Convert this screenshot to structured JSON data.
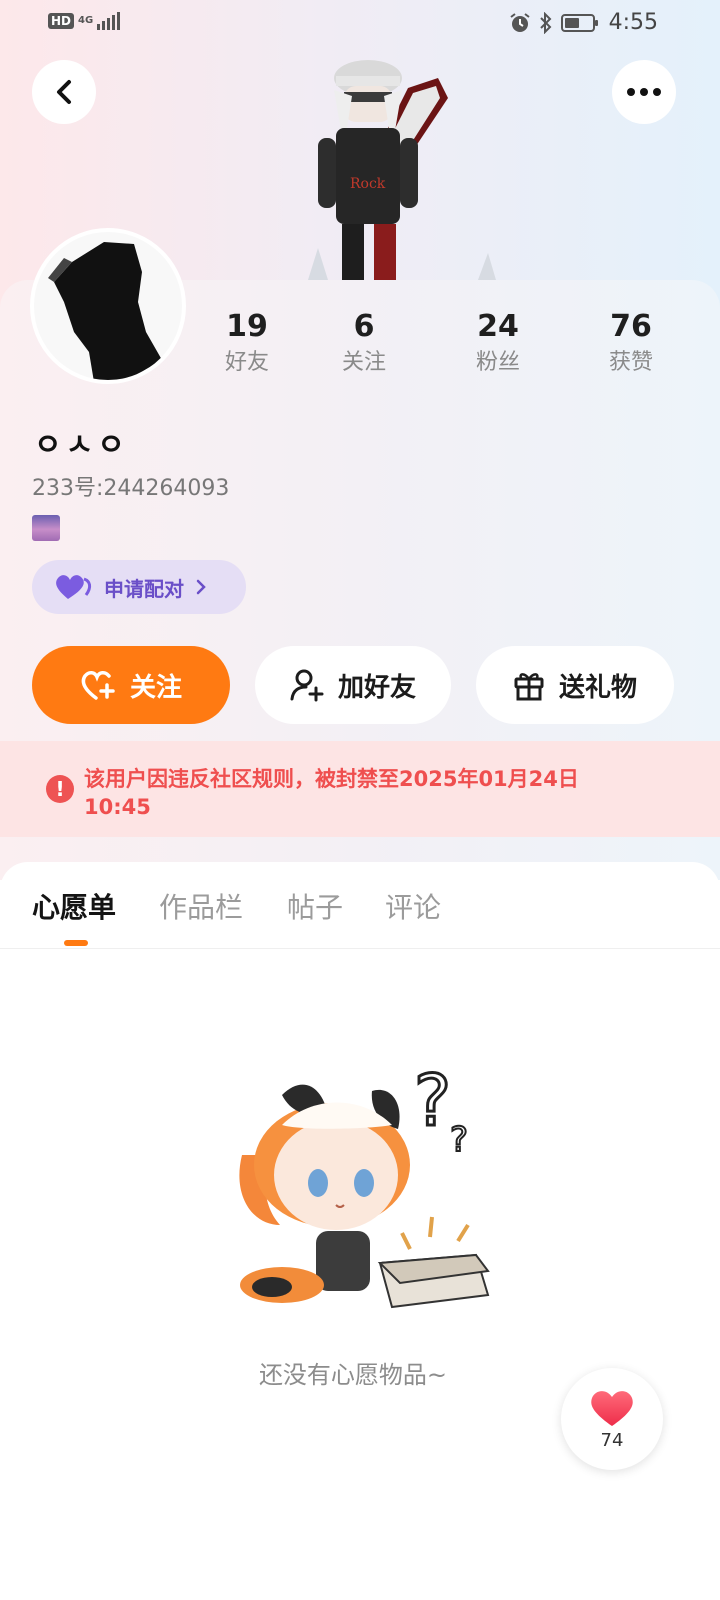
{
  "status_bar": {
    "hd": "HD",
    "network": "4G",
    "time": "4:55",
    "battery_level": 0.55,
    "icons": [
      "alarm-icon",
      "bluetooth-icon",
      "battery-icon"
    ]
  },
  "header": {
    "back_icon": "chevron-left-icon",
    "more_icon": "more-dots-icon"
  },
  "profile": {
    "stats": [
      {
        "value": "19",
        "label": "好友"
      },
      {
        "value": "6",
        "label": "关注"
      },
      {
        "value": "24",
        "label": "粉丝"
      },
      {
        "value": "76",
        "label": "获赞"
      }
    ],
    "nickname": "ㅇㅅㅇ",
    "uid": "233号:244264093",
    "pair_button": "申请配对"
  },
  "actions": {
    "follow": "关注",
    "add_friend": "加好友",
    "gift": "送礼物"
  },
  "ban_notice": "该用户因违反社区规则，被封禁至2025年01月24日10:45",
  "tabs": [
    {
      "label": "心愿单",
      "active": true
    },
    {
      "label": "作品栏",
      "active": false
    },
    {
      "label": "帖子",
      "active": false
    },
    {
      "label": "评论",
      "active": false
    }
  ],
  "empty_state": "还没有心愿物品~",
  "like_fab": {
    "count": "74"
  },
  "colors": {
    "accent": "#ff7a12",
    "ban_text": "#ef4f4f",
    "pair_purple": "#6a4fc8"
  }
}
